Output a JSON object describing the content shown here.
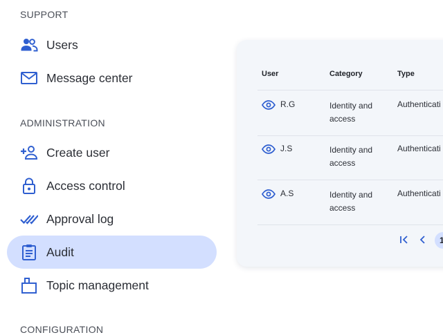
{
  "sidebar": {
    "sections": {
      "support": "SUPPORT",
      "administration": "ADMINISTRATION",
      "configuration": "CONFIGURATION"
    },
    "items": [
      {
        "label": "Users",
        "icon": "users-icon"
      },
      {
        "label": "Message center",
        "icon": "mail-icon"
      },
      {
        "label": "Create user",
        "icon": "add-user-icon"
      },
      {
        "label": "Access control",
        "icon": "lock-icon"
      },
      {
        "label": "Approval log",
        "icon": "double-check-icon"
      },
      {
        "label": "Audit",
        "icon": "clipboard-icon",
        "active": true
      },
      {
        "label": "Topic management",
        "icon": "topic-icon"
      }
    ]
  },
  "table": {
    "columns": [
      "User",
      "Category",
      "Type"
    ],
    "rows": [
      {
        "user": "R.G",
        "category": "Identity and access",
        "type": "Authenticati"
      },
      {
        "user": "J.S",
        "category": "Identity and access",
        "type": "Authenticati"
      },
      {
        "user": "A.S",
        "category": "Identity and access",
        "type": "Authenticati"
      }
    ],
    "pagination": {
      "current_page": "1"
    }
  },
  "colors": {
    "accent": "#2f5fd0",
    "active_bg": "#d3dfff",
    "card_bg": "#f3f6fa"
  }
}
